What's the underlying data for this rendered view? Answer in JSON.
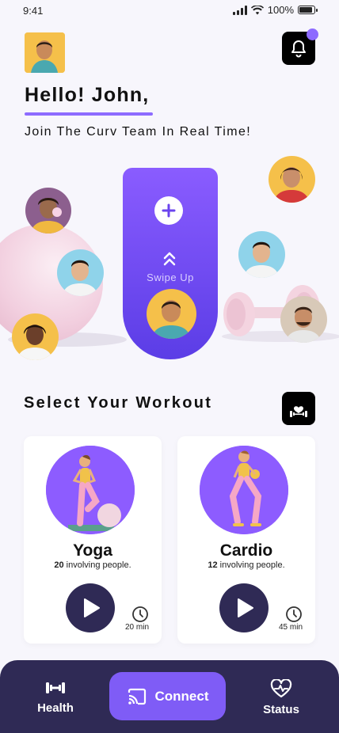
{
  "status_bar": {
    "time": "9:41",
    "battery": "100%"
  },
  "header": {
    "greeting": "Hello!  John,",
    "subtitle": "Join The Curv Team In Real Time!",
    "profile_avatar": "person-avatar",
    "notification_icon": "bell-icon",
    "accent": "#8d6bff"
  },
  "hero": {
    "swipe_label": "Swipe Up",
    "plus_icon": "plus-icon",
    "chevron_icon": "double-chevron-up-icon",
    "gradient": [
      "#8a5cff",
      "#5b3de6"
    ]
  },
  "workout": {
    "title": "Select Your Workout",
    "icon": "fitness-heart-icon",
    "cards": [
      {
        "title": "Yoga",
        "count": "20",
        "people_text": "involving people.",
        "duration": "20 min"
      },
      {
        "title": "Cardio",
        "count": "12",
        "people_text": "involving people.",
        "duration": "45 min"
      }
    ]
  },
  "nav": {
    "items": [
      {
        "label": "Health",
        "icon": "dumbbell-icon"
      },
      {
        "label": "Connect",
        "icon": "cast-icon"
      },
      {
        "label": "Status",
        "icon": "heart-pulse-icon"
      }
    ],
    "background": "#2f2a55",
    "active_color": "#7f5cf6"
  }
}
